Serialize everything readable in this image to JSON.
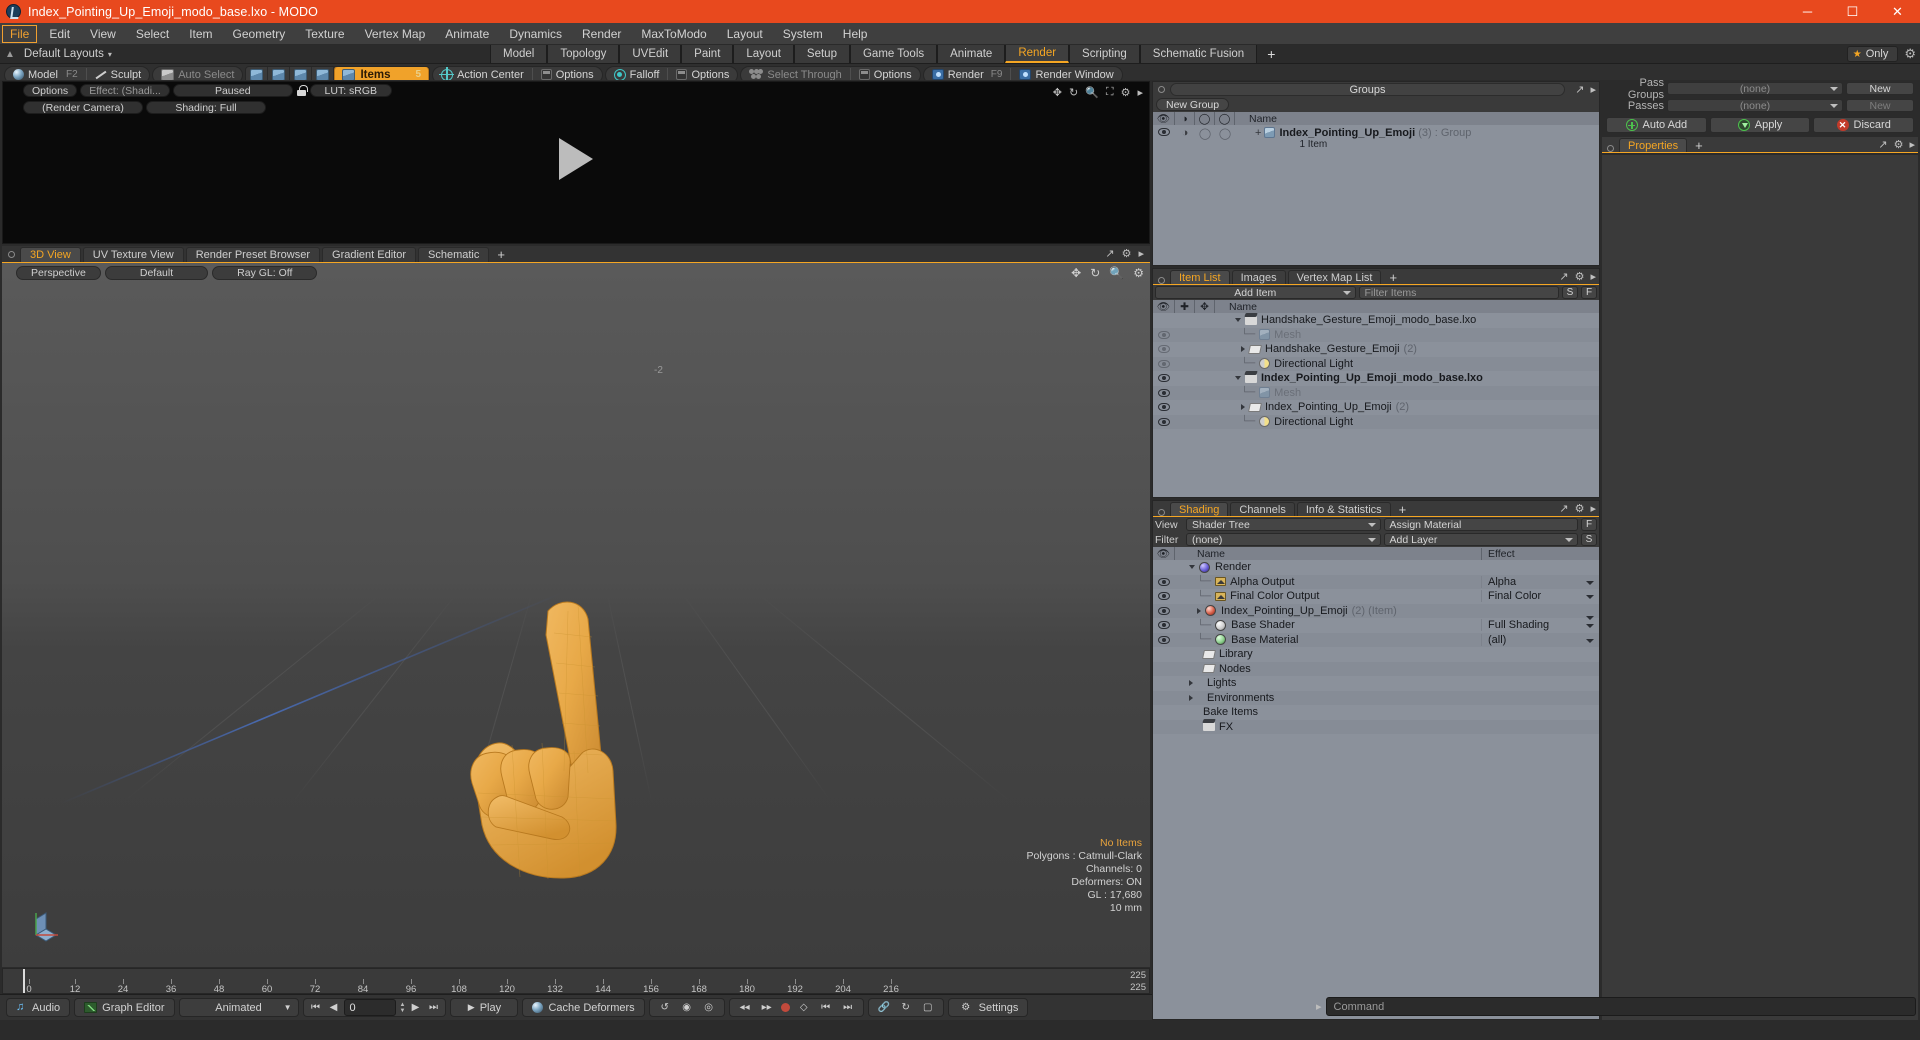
{
  "titlebar": {
    "title": "Index_Pointing_Up_Emoji_modo_base.lxo - MODO",
    "minimize": "─",
    "maximize": "☐",
    "close": "✕"
  },
  "menubar": {
    "items": [
      "File",
      "Edit",
      "View",
      "Select",
      "Item",
      "Geometry",
      "Texture",
      "Vertex Map",
      "Animate",
      "Dynamics",
      "Render",
      "MaxToModo",
      "Layout",
      "System",
      "Help"
    ],
    "active": "File"
  },
  "layoutrow": {
    "layouts_label": "Default Layouts",
    "caret": "▾",
    "tabs": [
      "Model",
      "Topology",
      "UVEdit",
      "Paint",
      "Layout",
      "Setup",
      "Game Tools",
      "Animate",
      "Render",
      "Scripting",
      "Schematic Fusion"
    ],
    "selected": "Render",
    "plus": "+",
    "only_label": "Only",
    "star": "★",
    "gear": "⚙"
  },
  "toolbar": {
    "model": "Model",
    "model_key": "F2",
    "sculpt": "Sculpt",
    "auto_select": "Auto Select",
    "items": "Items",
    "items_key": "5",
    "action_center": "Action Center",
    "options_1": "Options",
    "falloff": "Falloff",
    "options_2": "Options",
    "select_through": "Select Through",
    "options_3": "Options",
    "render": "Render",
    "render_key": "F9",
    "render_window": "Render Window"
  },
  "render_preview": {
    "options": "Options",
    "effect": "Effect: (Shadi...",
    "paused": "Paused",
    "lut": "LUT: sRGB",
    "render_camera": "(Render Camera)",
    "shading": "Shading: Full",
    "icons": [
      "move-icon",
      "refresh-icon",
      "zoom-icon",
      "fit-icon",
      "gear-icon",
      "chevron-right-icon"
    ]
  },
  "viewport_tabs": {
    "tabs": [
      "3D View",
      "UV Texture View",
      "Render Preset Browser",
      "Gradient Editor",
      "Schematic"
    ],
    "selected": "3D View",
    "plus": "+"
  },
  "viewport": {
    "perspective": "Perspective",
    "default": "Default",
    "raygl": "Ray GL: Off",
    "axis_label": "-2",
    "stats": {
      "no_items": "No Items",
      "polygons": "Polygons : Catmull-Clark",
      "channels": "Channels: 0",
      "deformers": "Deformers: ON",
      "gl": "GL : 17,680",
      "scale": "10 mm"
    }
  },
  "timeline": {
    "ticks": [
      0,
      12,
      24,
      36,
      48,
      60,
      72,
      84,
      96,
      108,
      120,
      132,
      144,
      156,
      168,
      180,
      192,
      204,
      216
    ],
    "end_top": "225",
    "end_bottom": "225"
  },
  "bottombar": {
    "audio": "Audio",
    "graph_editor": "Graph Editor",
    "animated": "Animated",
    "frame_value": "0",
    "play": "Play",
    "cache_deformers": "Cache Deformers",
    "settings": "Settings",
    "command_placeholder": "Command"
  },
  "groups_panel": {
    "title": "Groups",
    "new_group": "New Group",
    "columns": [
      "Name"
    ],
    "rows": [
      {
        "name": "Index_Pointing_Up_Emoji",
        "count": "(3)",
        "type": ": Group",
        "sub": "1 Item"
      }
    ]
  },
  "item_list": {
    "tabs": [
      "Item List",
      "Images",
      "Vertex Map List"
    ],
    "selected": "Item List",
    "plus": "+",
    "add_item": "Add Item",
    "filter_placeholder": "Filter Items",
    "btn_s": "S",
    "btn_f": "F",
    "col_name": "Name",
    "rows": [
      {
        "label": "Handshake_Gesture_Emoji_modo_base.lxo",
        "icon": "film-icon",
        "depth": 0,
        "expand": "down",
        "bold": false,
        "eye": false
      },
      {
        "label": "Mesh",
        "icon": "mesh-icon",
        "depth": 1,
        "expand": "dash",
        "bold": false,
        "eye": true,
        "greyed": true
      },
      {
        "label": "Handshake_Gesture_Emoji",
        "count": "(2)",
        "icon": "folder-icon",
        "depth": 1,
        "expand": "right",
        "bold": false,
        "eye": true
      },
      {
        "label": "Directional Light",
        "icon": "light-icon",
        "depth": 1,
        "expand": "dash",
        "bold": false,
        "eye": true
      },
      {
        "label": "Index_Pointing_Up_Emoji_modo_base.lxo",
        "icon": "film-icon",
        "depth": 0,
        "expand": "down",
        "bold": true,
        "eye": true
      },
      {
        "label": "Mesh",
        "icon": "mesh-icon",
        "depth": 1,
        "expand": "dash",
        "bold": false,
        "eye": true,
        "greyed": true
      },
      {
        "label": "Index_Pointing_Up_Emoji",
        "count": "(2)",
        "icon": "folder-icon",
        "depth": 1,
        "expand": "right",
        "bold": false,
        "eye": true
      },
      {
        "label": "Directional Light",
        "icon": "light-icon",
        "depth": 1,
        "expand": "dash",
        "bold": false,
        "eye": true
      }
    ]
  },
  "shading_panel": {
    "tabs": [
      "Shading",
      "Channels",
      "Info & Statistics"
    ],
    "selected": "Shading",
    "plus": "+",
    "view_label": "View",
    "view_value": "Shader Tree",
    "assign_material": "Assign Material",
    "btn_f": "F",
    "filter_label": "Filter",
    "filter_value": "(none)",
    "add_layer": "Add Layer",
    "btn_s": "S",
    "col_name": "Name",
    "col_effect": "Effect",
    "rows": [
      {
        "label": "Render",
        "icon": "sphere-blue-icon",
        "effect": "",
        "depth": 0,
        "expand": "down",
        "eye": false,
        "caret": false
      },
      {
        "label": "Alpha Output",
        "icon": "image-icon",
        "effect": "Alpha",
        "depth": 1,
        "expand": "dash",
        "eye": true,
        "caret": true
      },
      {
        "label": "Final Color Output",
        "icon": "image-icon",
        "effect": "Final Color",
        "depth": 1,
        "expand": "dash",
        "eye": true,
        "caret": true
      },
      {
        "label": "Index_Pointing_Up_Emoji",
        "count": "(2) (Item)",
        "icon": "sphere-red-icon",
        "effect": "",
        "depth": 1,
        "expand": "right",
        "eye": true,
        "caret": true
      },
      {
        "label": "Base Shader",
        "icon": "sphere-white-icon",
        "effect": "Full Shading",
        "depth": 1,
        "expand": "dash",
        "eye": true,
        "caret": true
      },
      {
        "label": "Base Material",
        "icon": "sphere-green-icon",
        "effect": "(all)",
        "depth": 1,
        "expand": "dash",
        "eye": true,
        "caret": true
      },
      {
        "label": "Library",
        "icon": "folder-icon",
        "effect": "",
        "depth": 1,
        "expand": "none",
        "eye": false,
        "caret": false
      },
      {
        "label": "Nodes",
        "icon": "folder-icon",
        "effect": "",
        "depth": 1,
        "expand": "none",
        "eye": false,
        "caret": false
      },
      {
        "label": "Lights",
        "icon": "none",
        "effect": "",
        "depth": 1,
        "expand": "right",
        "eye": false,
        "caret": false
      },
      {
        "label": "Environments",
        "icon": "none",
        "effect": "",
        "depth": 1,
        "expand": "right",
        "eye": false,
        "caret": false
      },
      {
        "label": "Bake Items",
        "icon": "none",
        "effect": "",
        "depth": 1,
        "expand": "none",
        "eye": false,
        "caret": false
      },
      {
        "label": "FX",
        "icon": "film-icon",
        "effect": "",
        "depth": 1,
        "expand": "none",
        "eye": false,
        "caret": false
      }
    ]
  },
  "passes_panel": {
    "pass_groups_label": "Pass Groups",
    "pass_groups_value": "(none)",
    "pass_groups_new": "New",
    "passes_label": "Passes",
    "passes_value": "(none)",
    "passes_new": "New",
    "auto_add": "Auto Add",
    "apply": "Apply",
    "discard": "Discard"
  },
  "properties_panel": {
    "tabs": [
      "Properties"
    ],
    "selected": "Properties",
    "plus": "+"
  },
  "colors": {
    "title_bar": "#e8491e",
    "accent": "#f5a623",
    "panel_bg": "#3a3a3a",
    "tree_bg": "#8b919b",
    "viewport_bg": "#4a4a4a"
  }
}
